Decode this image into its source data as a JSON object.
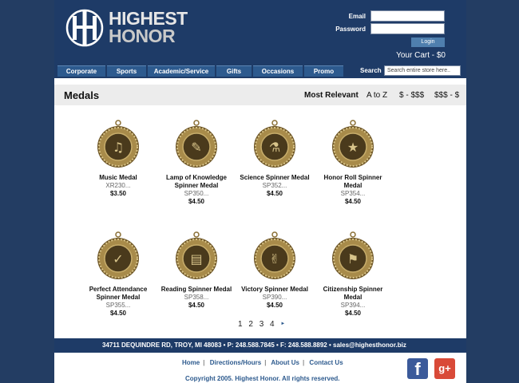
{
  "brand": {
    "line1": "HIGHEST",
    "line2": "HONOR"
  },
  "login": {
    "email_label": "Email",
    "password_label": "Password",
    "button_label": "Login"
  },
  "cart": "Your Cart - $0",
  "nav": [
    "Corporate",
    "Sports",
    "Academic/Service",
    "Gifts",
    "Occasions",
    "Promo"
  ],
  "search": {
    "label": "Search",
    "placeholder": "Search entire store here.."
  },
  "section_title": "Medals",
  "sort": [
    "Most Relevant",
    "A to Z",
    "$ - $$$",
    "$$$ - $"
  ],
  "products": [
    {
      "name": "Music Medal",
      "sku": "XR230...",
      "price": "$3.50",
      "icon": "music-medal-icon"
    },
    {
      "name": "Lamp of Knowledge Spinner Medal",
      "sku": "SP350...",
      "price": "$4.50",
      "icon": "lamp-medal-icon"
    },
    {
      "name": "Science Spinner Medal",
      "sku": "SP352...",
      "price": "$4.50",
      "icon": "science-medal-icon"
    },
    {
      "name": "Honor Roll Spinner Medal",
      "sku": "SP354...",
      "price": "$4.50",
      "icon": "honor-roll-medal-icon"
    },
    {
      "name": "Perfect Attendance Spinner Medal",
      "sku": "SP355...",
      "price": "$4.50",
      "icon": "attendance-medal-icon"
    },
    {
      "name": "Reading Spinner Medal",
      "sku": "SP358...",
      "price": "$4.50",
      "icon": "reading-medal-icon"
    },
    {
      "name": "Victory Spinner Medal",
      "sku": "SP390...",
      "price": "$4.50",
      "icon": "victory-medal-icon"
    },
    {
      "name": "Citizenship Spinner Medal",
      "sku": "SP394...",
      "price": "$4.50",
      "icon": "citizenship-medal-icon"
    }
  ],
  "pagination": {
    "pages": [
      "1",
      "2",
      "3",
      "4"
    ],
    "next": "►"
  },
  "footer": {
    "address_line": "34711 DEQUINDRE RD, TROY, MI 48083  •  P: 248.588.7845  •  F: 248.588.8892  •  sales@highesthonor.biz",
    "links": [
      "Home",
      "Directions/Hours",
      "About Us",
      "Contact Us"
    ],
    "copyright": "Copyright 2005. Highest Honor. All rights reserved."
  },
  "social": {
    "facebook": "f",
    "googleplus": "g+"
  },
  "colors": {
    "navy": "#1e3b67",
    "nav_button": "#2d5a8e",
    "background": "#233d63",
    "medal_gold": "#a88b4a"
  }
}
